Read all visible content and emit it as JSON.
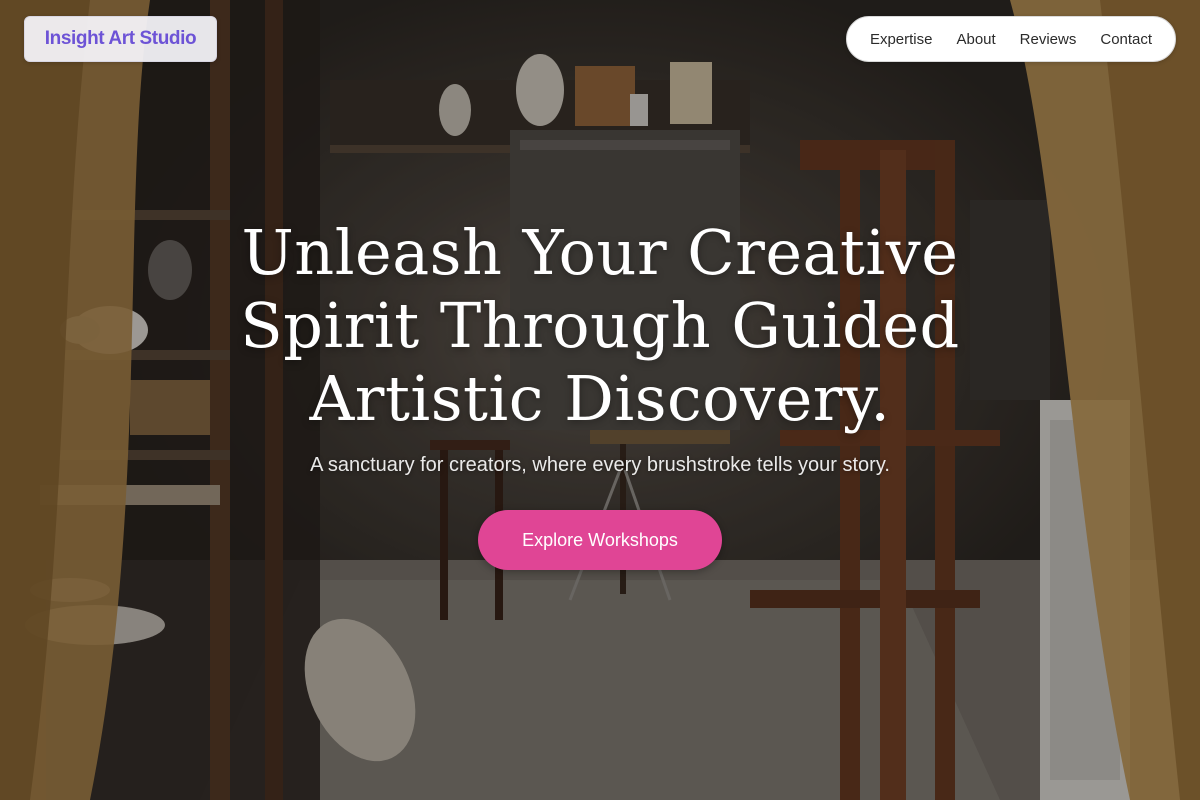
{
  "logo": {
    "text": "Insight Art Studio"
  },
  "nav": {
    "items": [
      {
        "label": "Expertise"
      },
      {
        "label": "About"
      },
      {
        "label": "Reviews"
      },
      {
        "label": "Contact"
      }
    ]
  },
  "hero": {
    "title_lines": [
      "Unleash Your Creative",
      "Spirit Through Guided",
      "Artistic Discovery."
    ],
    "subtitle": "A sanctuary for creators, where every brushstroke tells your story.",
    "cta_label": "Explore Workshops"
  },
  "colors": {
    "logo_text": "#6d53d6",
    "cta_background": "#e04595",
    "nav_background": "#ffffff",
    "hero_text": "#ffffff"
  },
  "icons": {
    "background": "art-studio-photo"
  }
}
